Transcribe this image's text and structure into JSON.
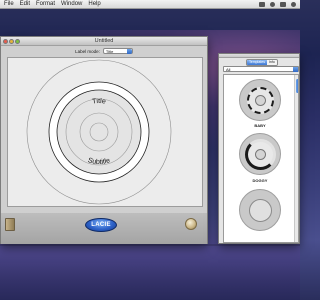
{
  "menubar": {
    "items": [
      "File",
      "Edit",
      "Format",
      "Window",
      "Help"
    ]
  },
  "main_window": {
    "title": "Untitled",
    "label_mode_label": "Label mode:",
    "label_mode_value": "Title",
    "disc": {
      "title_text": "Title",
      "subtitle_text": "Subtitle"
    },
    "logo_text": "LACIE"
  },
  "templates_panel": {
    "tabs": [
      "Templates",
      "Info"
    ],
    "active_tab": "Templates",
    "category_value": "All",
    "items": [
      {
        "label": "BABY"
      },
      {
        "label": "DOGGY"
      }
    ]
  },
  "colors": {
    "accent": "#3d79d6",
    "lacie_blue": "#2d62c9",
    "desktop": "#2b2f66"
  }
}
